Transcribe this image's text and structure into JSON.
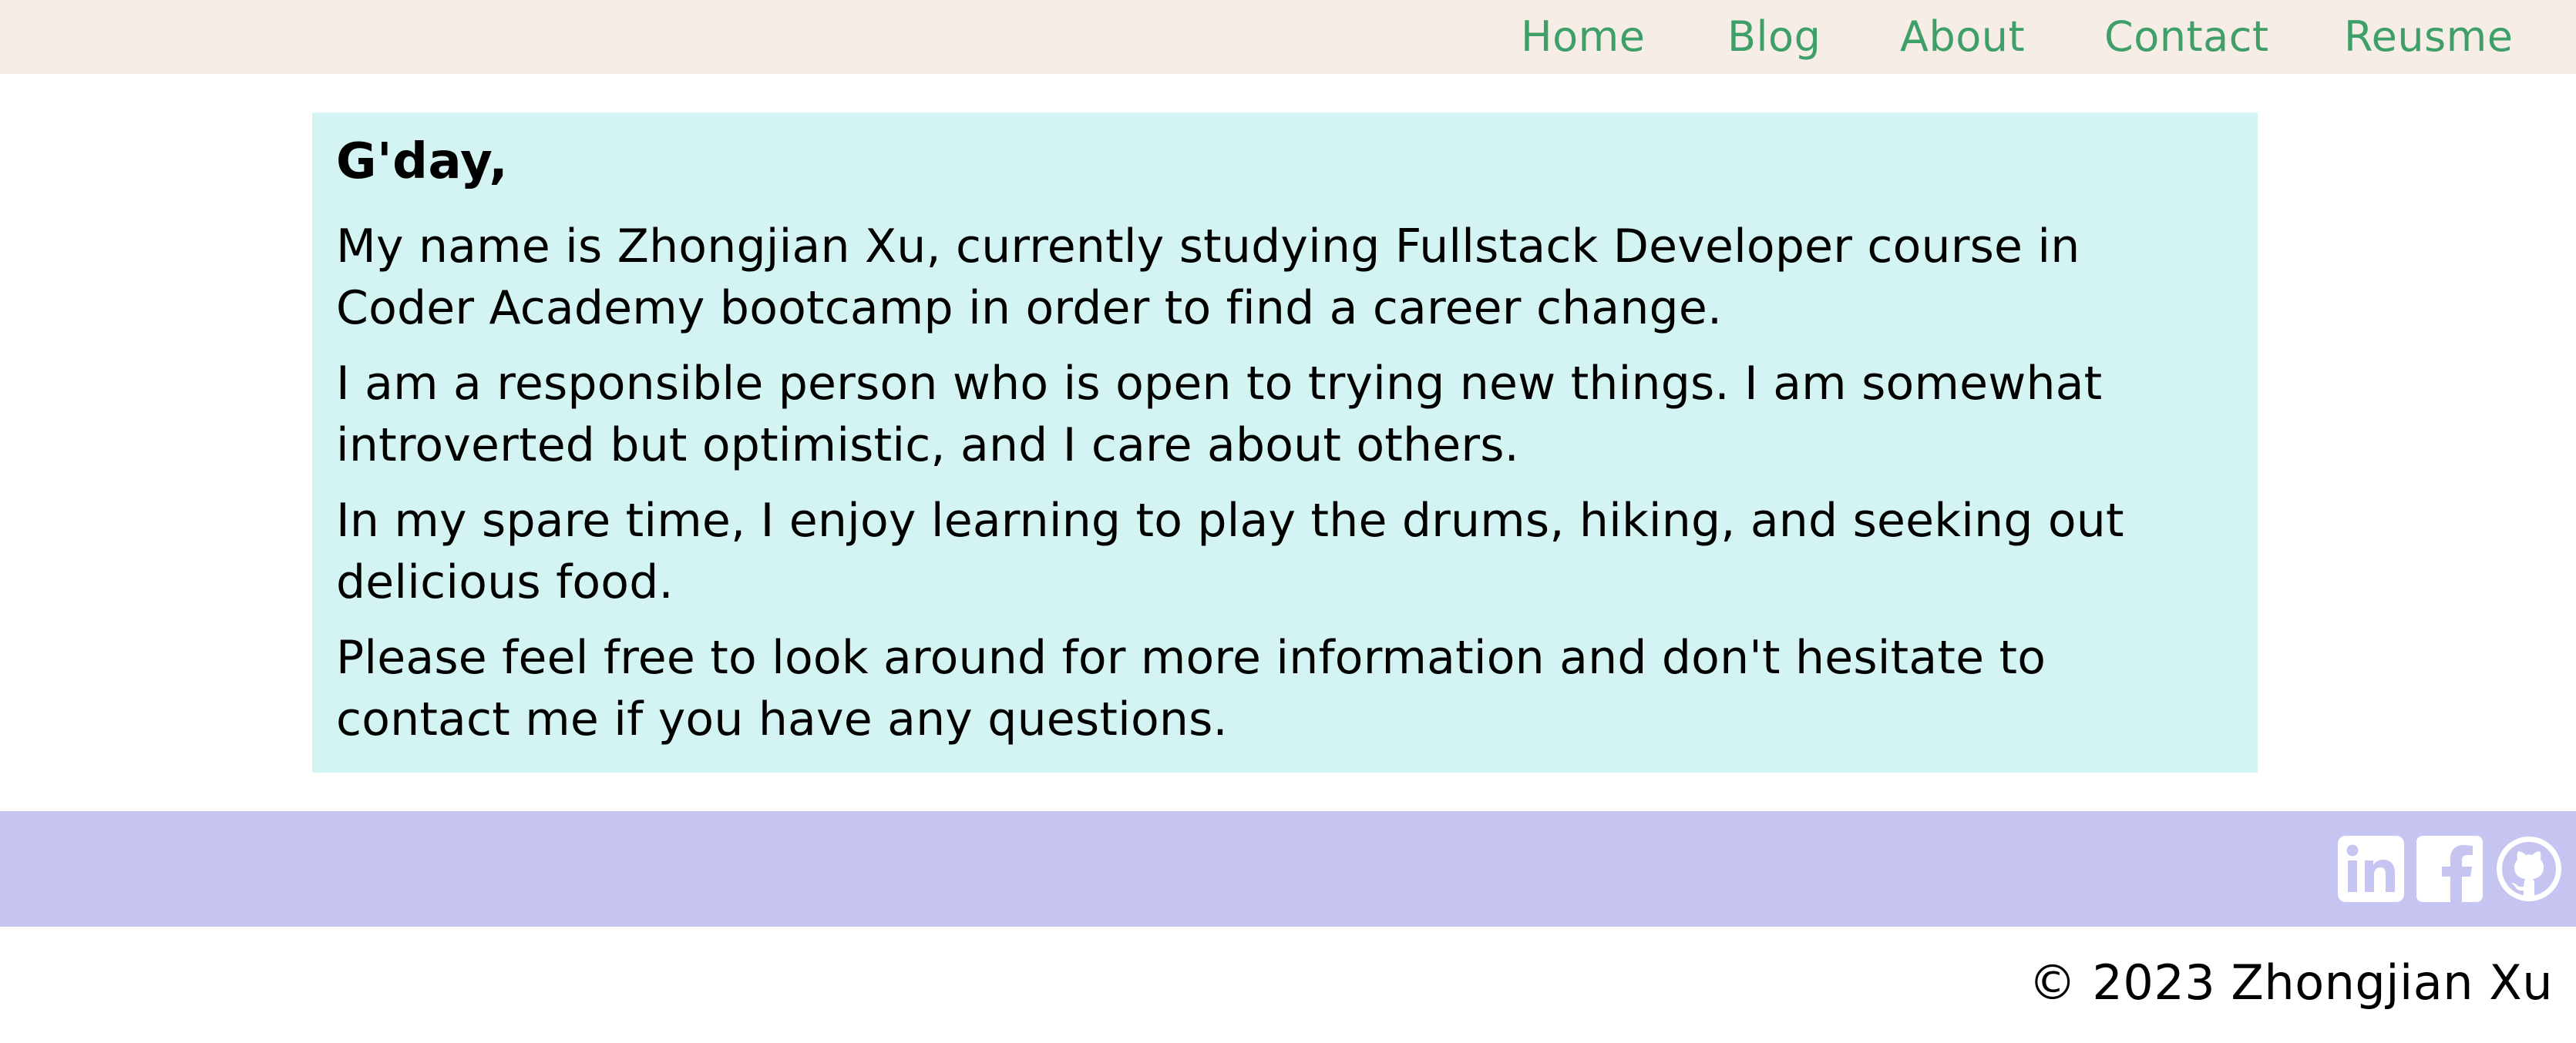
{
  "nav": {
    "items": [
      {
        "label": "Home"
      },
      {
        "label": "Blog"
      },
      {
        "label": "About"
      },
      {
        "label": "Contact"
      },
      {
        "label": "Reusme"
      }
    ]
  },
  "intro": {
    "greeting": "G'day,",
    "paragraphs": [
      [
        "My name is Zhongjian Xu, currently studying Fullstack Developer course in",
        "Coder Academy bootcamp in order to find a career change."
      ],
      [
        "I am a responsible person who is open to trying new things. I am somewhat",
        "introverted but optimistic, and I care about others."
      ],
      [
        "In my spare time, I enjoy learning to play the drums, hiking, and seeking out",
        "delicious food."
      ],
      [
        "Please feel free to look around for more information and don't hesitate to",
        "contact me if you have any questions."
      ]
    ]
  },
  "footer": {
    "social": [
      {
        "icon": "linkedin-icon"
      },
      {
        "icon": "facebook-icon"
      },
      {
        "icon": "github-icon"
      }
    ],
    "copyright": "© 2023 Zhongjian Xu"
  },
  "colors": {
    "nav_background": "#f5ede6",
    "nav_link": "#3f9f68",
    "card_background": "#d4f4f3",
    "footer_background": "#c6c4f1",
    "icon_color": "#ffffff"
  }
}
